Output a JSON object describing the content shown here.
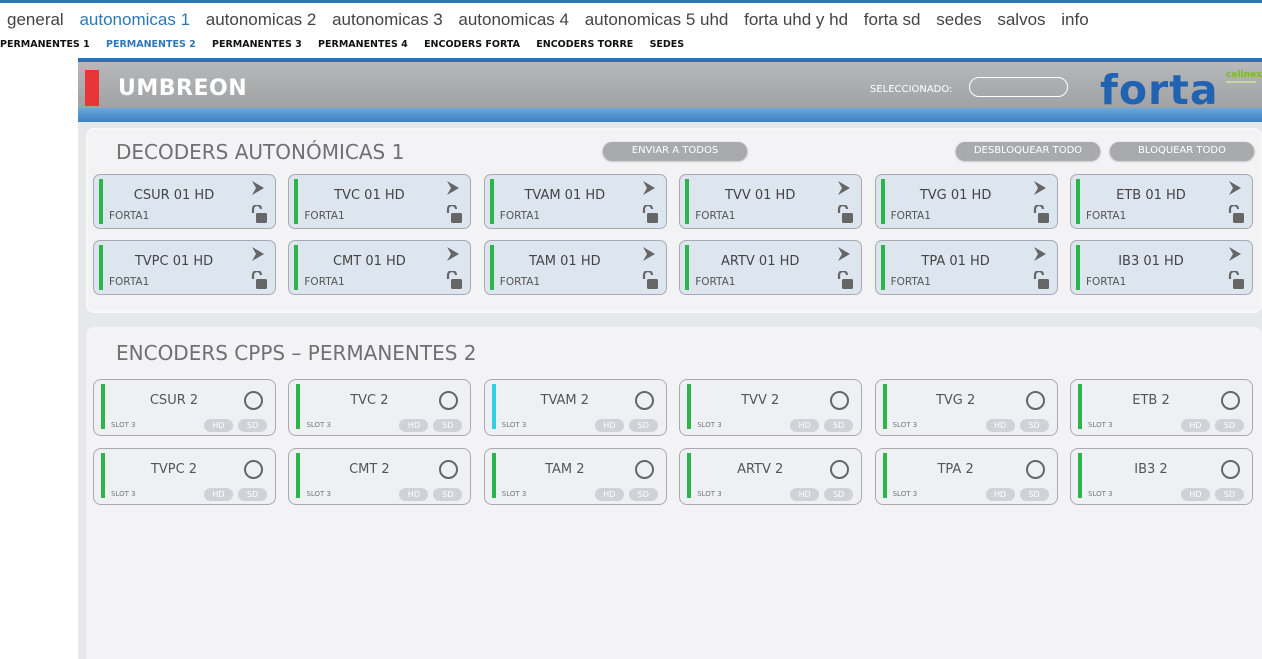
{
  "nav": {
    "items": [
      "general",
      "autonomicas 1",
      "autonomicas 2",
      "autonomicas 3",
      "autonomicas 4",
      "autonomicas 5 uhd",
      "forta uhd y hd",
      "forta sd",
      "sedes",
      "salvos",
      "info"
    ],
    "active_index": 1
  },
  "subnav": {
    "items": [
      "PERMANENTES 1",
      "PERMANENTES 2",
      "PERMANENTES 3",
      "PERMANENTES 4",
      "ENCODERS FORTA",
      "ENCODERS TORRE",
      "SEDES"
    ],
    "active_index": 1
  },
  "header": {
    "title": "UMBREON",
    "selected_label": "SELECCIONADO:",
    "selected_value": "",
    "brand": "forta",
    "brand_secondary": "cellnex"
  },
  "decoders": {
    "title": "DECODERS AUTONÓMICAS 1",
    "send_all": "ENVIAR A TODOS",
    "unlock_all": "DESBLOQUEAR TODO",
    "lock_all": "BLOQUEAR TODO",
    "cards": [
      {
        "name": "CSUR 01 HD",
        "source": "FORTA1"
      },
      {
        "name": "TVC 01 HD",
        "source": "FORTA1"
      },
      {
        "name": "TVAM 01 HD",
        "source": "FORTA1"
      },
      {
        "name": "TVV 01 HD",
        "source": "FORTA1"
      },
      {
        "name": "TVG 01 HD",
        "source": "FORTA1"
      },
      {
        "name": "ETB 01 HD",
        "source": "FORTA1"
      },
      {
        "name": "TVPC 01 HD",
        "source": "FORTA1"
      },
      {
        "name": "CMT 01 HD",
        "source": "FORTA1"
      },
      {
        "name": "TAM 01 HD",
        "source": "FORTA1"
      },
      {
        "name": "ARTV 01 HD",
        "source": "FORTA1"
      },
      {
        "name": "TPA 01 HD",
        "source": "FORTA1"
      },
      {
        "name": "IB3 01 HD",
        "source": "FORTA1"
      }
    ]
  },
  "encoders": {
    "title": "ENCODERS CPPS – PERMANENTES 2",
    "cards": [
      {
        "name": "CSUR 2",
        "slot": "SLOT 3",
        "hd": "HD",
        "sd": "SD",
        "status_color": "#2cb44d"
      },
      {
        "name": "TVC 2",
        "slot": "SLOT 3",
        "hd": "HD",
        "sd": "SD",
        "status_color": "#2cb44d"
      },
      {
        "name": "TVAM 2",
        "slot": "SLOT 3",
        "hd": "HD",
        "sd": "SD",
        "status_color": "#2fd0e6"
      },
      {
        "name": "TVV 2",
        "slot": "SLOT 3",
        "hd": "HD",
        "sd": "SD",
        "status_color": "#2cb44d"
      },
      {
        "name": "TVG 2",
        "slot": "SLOT 3",
        "hd": "HD",
        "sd": "SD",
        "status_color": "#2cb44d"
      },
      {
        "name": "ETB 2",
        "slot": "SLOT 3",
        "hd": "HD",
        "sd": "SD",
        "status_color": "#2cb44d"
      },
      {
        "name": "TVPC 2",
        "slot": "SLOT 3",
        "hd": "HD",
        "sd": "SD",
        "status_color": "#2cb44d"
      },
      {
        "name": "CMT 2",
        "slot": "SLOT 3",
        "hd": "HD",
        "sd": "SD",
        "status_color": "#2cb44d"
      },
      {
        "name": "TAM 2",
        "slot": "SLOT 3",
        "hd": "HD",
        "sd": "SD",
        "status_color": "#2cb44d"
      },
      {
        "name": "ARTV 2",
        "slot": "SLOT 3",
        "hd": "HD",
        "sd": "SD",
        "status_color": "#2cb44d"
      },
      {
        "name": "TPA 2",
        "slot": "SLOT 3",
        "hd": "HD",
        "sd": "SD",
        "status_color": "#2cb44d"
      },
      {
        "name": "IB3 2",
        "slot": "SLOT 3",
        "hd": "HD",
        "sd": "SD",
        "status_color": "#2cb44d"
      }
    ]
  },
  "colors": {
    "accent_blue": "#2e77b9",
    "brand_blue": "#2163b1",
    "status_green": "#2cb44d",
    "alert_red": "#e83535"
  }
}
